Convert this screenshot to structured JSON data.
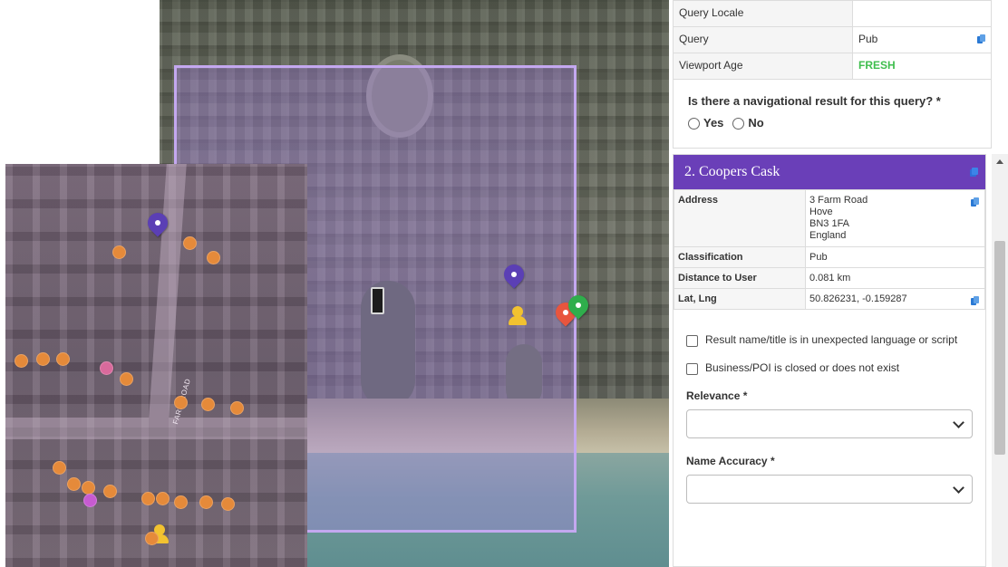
{
  "map": {
    "street_label": "FARM ROAD"
  },
  "query_table": [
    {
      "label": "Query Locale",
      "value": ""
    },
    {
      "label": "Query",
      "value": "Pub"
    },
    {
      "label": "Viewport Age",
      "value": "FRESH"
    }
  ],
  "navigational": {
    "question": "Is there a navigational result for this query? *",
    "options": [
      "Yes",
      "No"
    ]
  },
  "result": {
    "title": "2. Coopers Cask",
    "fields": {
      "address_label": "Address",
      "address_lines": [
        "3 Farm Road",
        "Hove",
        "BN3 1FA",
        "England"
      ],
      "classification_label": "Classification",
      "classification": "Pub",
      "distance_label": "Distance to User",
      "distance": "0.081 km",
      "latlng_label": "Lat, Lng",
      "latlng": "50.826231, -0.159287"
    },
    "checks": [
      "Result name/title is in unexpected language or script",
      "Business/POI is closed or does not exist"
    ],
    "relevance_label": "Relevance *",
    "name_accuracy_label": "Name Accuracy *"
  },
  "colors": {
    "header": "#6a3fb8",
    "viewport": "#c4a8f0",
    "fresh": "#3fbe4e"
  },
  "icons": [
    "copy-icon",
    "map-pin-icon",
    "phone-icon",
    "user-location-icon",
    "poi-icon",
    "chevron-down-icon"
  ]
}
